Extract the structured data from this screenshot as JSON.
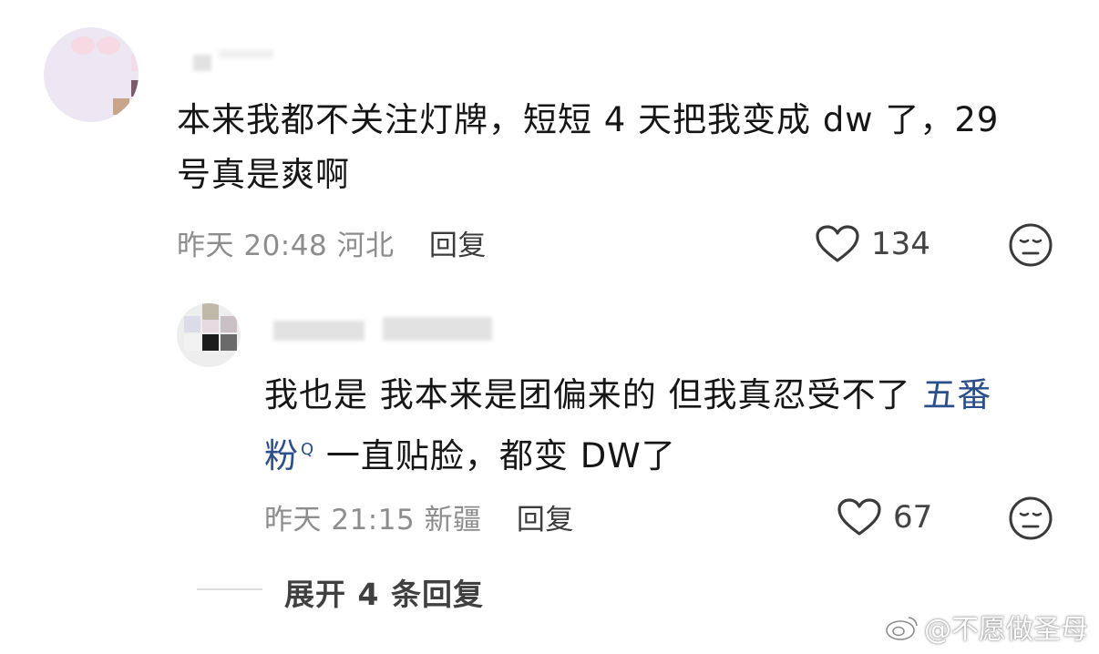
{
  "comment": {
    "text_line1": "本来我都不关注灯牌，短短 4 天把我变成 dw 了，29",
    "text_line2": "号真是爽啊",
    "time": "昨天 20:48",
    "location": "河北",
    "reply_label": "回复",
    "likes": "134"
  },
  "reply": {
    "text_part1": "我也是 我本来是团偏来的 但我真忍受不了 ",
    "topic_part1": "五番",
    "topic_part2": "粉",
    "text_part2": " 一直贴脸，都变 DW了",
    "time": "昨天 21:15",
    "location": "新疆",
    "reply_label": "回复",
    "likes": "67"
  },
  "expand_label": "展开 4 条回复",
  "watermark": "@不愿做圣母",
  "colors": {
    "topic_link": "#2b4f8a",
    "meta_gray": "#8d8d8d"
  }
}
